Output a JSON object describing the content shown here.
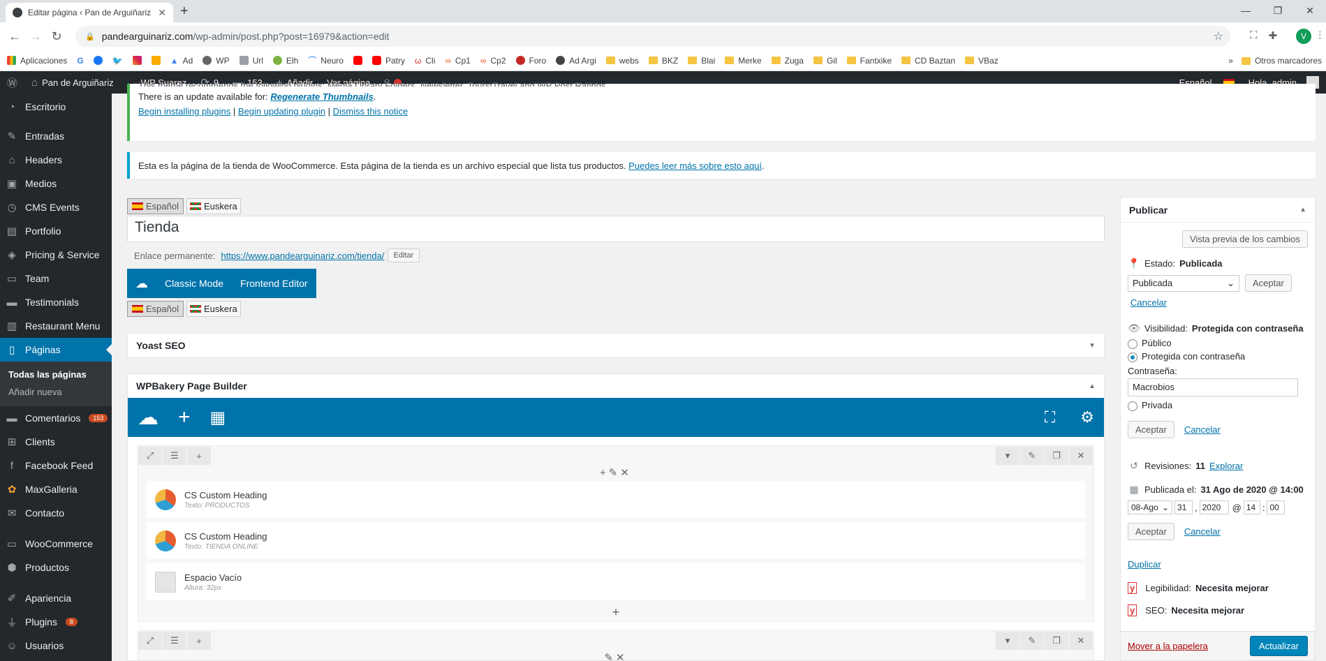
{
  "browser": {
    "tab_title": "Editar página ‹ Pan de Arguiñariz",
    "url_host": "pandearguinariz.com",
    "url_path": "/wp-admin/post.php?post=16979&action=edit",
    "avatar_letter": "V",
    "bookmarks": [
      "Aplicaciones",
      "Ad",
      "WP",
      "Url",
      "Elh",
      "Neuro",
      "Patry",
      "Cli",
      "Cp1",
      "Cp2",
      "Foro",
      "Ad Argi",
      "webs",
      "BKZ",
      "Blai",
      "Merke",
      "Zuga",
      "Gil",
      "Fantxike",
      "CD Baztan",
      "VBaz"
    ],
    "other_bookmarks": "Otros marcadores"
  },
  "adminbar": {
    "site": "Pan de Arguiñariz",
    "theme": "WP Suarez",
    "updates": "9",
    "comments": "153",
    "new": "Añadir",
    "view": "Ver página",
    "language": "Español",
    "greeting": "Hola, admin"
  },
  "sidebar": {
    "items": [
      {
        "label": "Escritorio",
        "icon": "dashboard-icon"
      },
      {
        "label": "Entradas",
        "icon": "pin-icon"
      },
      {
        "label": "Headers",
        "icon": "home-icon"
      },
      {
        "label": "Medios",
        "icon": "media-icon"
      },
      {
        "label": "CMS Events",
        "icon": "clock-icon"
      },
      {
        "label": "Portfolio",
        "icon": "portfolio-icon"
      },
      {
        "label": "Pricing & Service",
        "icon": "tag-icon"
      },
      {
        "label": "Team",
        "icon": "team-icon"
      },
      {
        "label": "Testimonials",
        "icon": "testimonial-icon"
      },
      {
        "label": "Restaurant Menu",
        "icon": "menu-icon"
      },
      {
        "label": "Páginas",
        "icon": "pages-icon"
      }
    ],
    "submenu": [
      "Todas las páginas",
      "Añadir nueva"
    ],
    "items2": [
      {
        "label": "Comentarios",
        "icon": "comments-icon",
        "badge": "153"
      },
      {
        "label": "Clients",
        "icon": "clients-icon"
      },
      {
        "label": "Facebook Feed",
        "icon": "facebook-icon"
      },
      {
        "label": "MaxGalleria",
        "icon": "gallery-icon"
      },
      {
        "label": "Contacto",
        "icon": "mail-icon"
      }
    ],
    "items3": [
      {
        "label": "WooCommerce",
        "icon": "woo-icon"
      },
      {
        "label": "Productos",
        "icon": "products-icon"
      }
    ],
    "items4": [
      {
        "label": "Apariencia",
        "icon": "brush-icon"
      },
      {
        "label": "Plugins",
        "icon": "plugin-icon",
        "badge": "8"
      },
      {
        "label": "Usuarios",
        "icon": "users-icon"
      }
    ]
  },
  "notices": {
    "plugins_line": "This theme recommends the following plugins: Media Library Folders, Newsletter, TourstTravel and WP Post Ratings.",
    "update_prefix": "There is an update available for: ",
    "update_plugin": "Regenerate Thumbnails",
    "update_suffix": ".",
    "begin_install": "Begin installing plugins",
    "begin_update": "Begin updating plugin",
    "dismiss": "Dismiss this notice",
    "pipe": "|",
    "woo_text": "Esta es la página de la tienda de WooCommerce. Esta página de la tienda es un archivo especial que lista tus productos.",
    "woo_link": "Puedes leer más sobre esto aquí"
  },
  "editor": {
    "lang1": "Español",
    "lang2": "Euskera",
    "title": "Tienda",
    "permalink_label": "Enlace permanente:",
    "permalink_url": "https://www.pandearguinariz.com/tienda/",
    "edit_btn": "Editar",
    "classic_mode": "Classic Mode",
    "frontend_editor": "Frontend Editor"
  },
  "yoast_box": {
    "title": "Yoast SEO"
  },
  "wpbakery": {
    "title": "WPBakery Page Builder",
    "elements": [
      {
        "name": "CS Custom Heading",
        "sub": "Texto: PRODUCTOS"
      },
      {
        "name": "CS Custom Heading",
        "sub": "Texto: TIENDA ONLINE"
      },
      {
        "name": "Espacio Vacío",
        "sub": "Altura: 32px"
      }
    ]
  },
  "publish": {
    "title": "Publicar",
    "preview": "Vista previa de los cambios",
    "status_label": "Estado:",
    "status_value": "Publicada",
    "status_select": "Publicada",
    "accept": "Aceptar",
    "cancel": "Cancelar",
    "visibility_label": "Visibilidad:",
    "visibility_value": "Protegida con contraseña",
    "opt_public": "Público",
    "opt_protected": "Protegida con contraseña",
    "password_label": "Contraseña:",
    "password_value": "Macrobios",
    "opt_private": "Privada",
    "revisions_label": "Revisiones:",
    "revisions_value": "11",
    "revisions_link": "Explorar",
    "published_label": "Publicada el:",
    "published_value": "31 Ago de 2020 @ 14:00",
    "month": "08-Ago",
    "day": "31",
    "year": "2020",
    "at": "@",
    "hour": "14",
    "colon": ":",
    "comma": ",",
    "minute": "00",
    "duplicate": "Duplicar",
    "readability_label": "Legibilidad:",
    "readability_value": "Necesita mejorar",
    "seo_label": "SEO:",
    "seo_value": "Necesita mejorar",
    "trash": "Mover a la papelera",
    "update": "Actualizar"
  }
}
